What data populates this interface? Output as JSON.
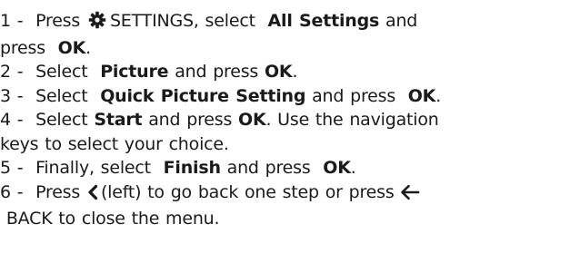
{
  "steps": [
    {
      "num": "1 -",
      "l1a": "Press",
      "l1b": "SETTINGS, select",
      "l1c": "All Settings",
      "l1d": "and",
      "l2a": "press",
      "l2b": "OK",
      "l2c": "."
    },
    {
      "num": "2 -",
      "a": "Select",
      "b": "Picture",
      "c": "and press",
      "d": "OK",
      "e": "."
    },
    {
      "num": "3 -",
      "a": "Select",
      "b": "Quick Picture Setting",
      "c": "and press",
      "d": "OK",
      "e": "."
    },
    {
      "num": "4 -",
      "a": "Select",
      "b": "Start",
      "c": "and press",
      "d": "OK",
      "e": ". Use the navigation",
      "l2": "keys to select your choice."
    },
    {
      "num": "5 -",
      "a": "Finally, select",
      "b": "Finish",
      "c": "and press",
      "d": "OK",
      "e": "."
    },
    {
      "num": "6 -",
      "a": "Press",
      "b": "(left) to go back one step or press",
      "l2": "BACK to close the menu."
    }
  ],
  "icons": {
    "settings": "gear-icon",
    "left": "chevron-left-icon",
    "back": "arrow-left-icon"
  }
}
